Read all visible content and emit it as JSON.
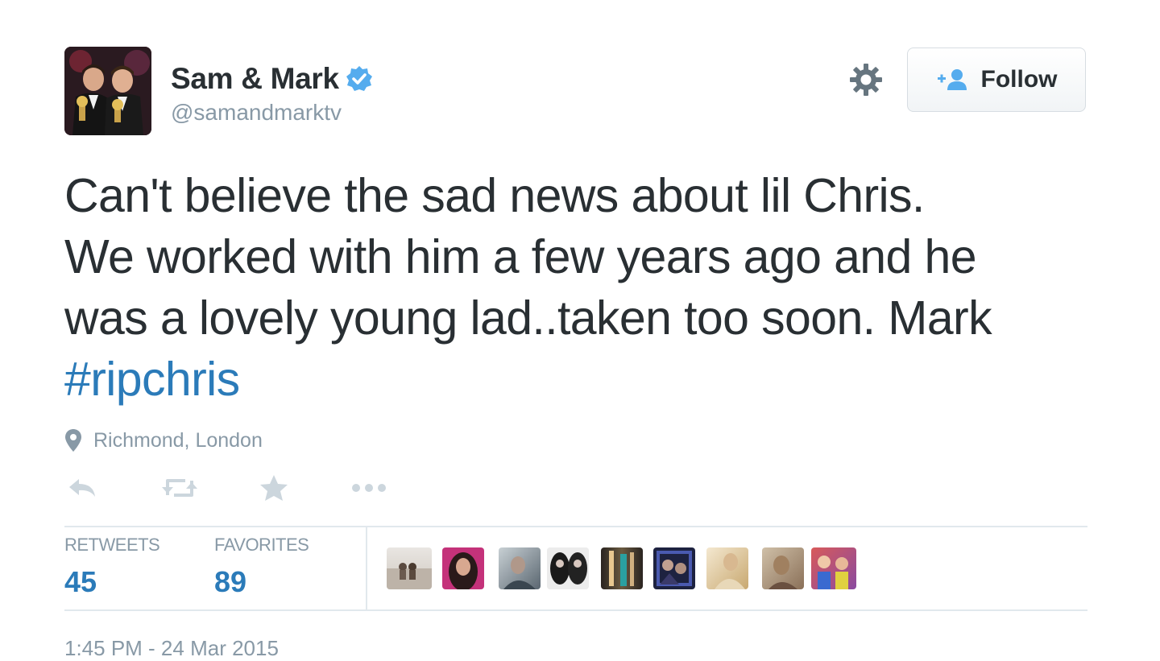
{
  "tweet": {
    "author": {
      "display_name": "Sam & Mark",
      "handle": "@samandmarktv",
      "verified": true,
      "avatar_icon": "profile-photo"
    },
    "follow_button_label": "Follow",
    "text_lines": [
      "Can't believe the sad news about lil Chris.",
      "We worked with him a few years ago and he",
      "was a lovely young lad..taken too soon. Mark"
    ],
    "hashtag": "#ripchris",
    "location": "Richmond, London",
    "actions": [
      "reply-icon",
      "retweet-icon",
      "favorite-icon",
      "more-icon"
    ],
    "stats": {
      "retweets_label": "RETWEETS",
      "retweets_count": "45",
      "favorites_label": "FAVORITES",
      "favorites_count": "89"
    },
    "timestamp": "1:45 PM - 24 Mar 2015"
  },
  "colors": {
    "text": "#292f33",
    "muted": "#8899a6",
    "link": "#2b7bb9",
    "verified": "#55acee",
    "divider": "#e1e8ed"
  }
}
